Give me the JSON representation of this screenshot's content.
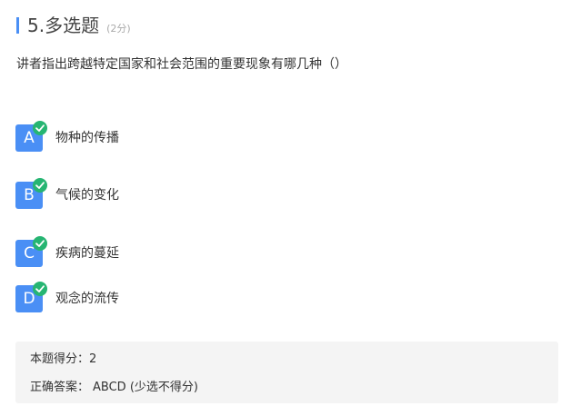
{
  "question": {
    "number_title": "5.多选题",
    "score_hint": "(2分)",
    "stem": "讲者指出跨越特定国家和社会范围的重要现象有哪几种（）"
  },
  "options": [
    {
      "letter": "A",
      "text": "物种的传播",
      "selected": true
    },
    {
      "letter": "B",
      "text": "气候的变化",
      "selected": true
    },
    {
      "letter": "C",
      "text": "疾病的蔓延",
      "selected": true
    },
    {
      "letter": "D",
      "text": "观念的流传",
      "selected": true
    }
  ],
  "result": {
    "score_label": "本题得分：",
    "score_value": "2",
    "answer_label": "正确答案：",
    "answer_value": "ABCD (少选不得分)"
  },
  "colors": {
    "accent": "#4a8ff5",
    "check": "#26b572",
    "panel": "#f4f4f4"
  }
}
